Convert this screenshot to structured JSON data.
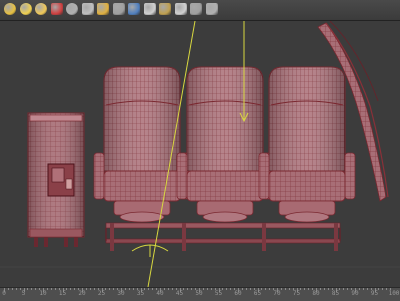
{
  "toolbar": {
    "tools": [
      {
        "icon": "sun-light-icon",
        "color": "#e8c040"
      },
      {
        "icon": "sun-light-icon",
        "color": "#f0d050"
      },
      {
        "icon": "omni-light-icon",
        "color": "#f0c858"
      },
      {
        "icon": "flag-icon",
        "color": "#d04040"
      },
      {
        "icon": "sphere-icon",
        "color": "#b0b0b0"
      },
      {
        "icon": "teapot-icon",
        "color": "#c0c0c0"
      },
      {
        "icon": "lights-icon",
        "color": "#e0b040"
      },
      {
        "icon": "camera-icon",
        "color": "#a0a0a0"
      },
      {
        "icon": "color-swatch-icon",
        "color": "#5080c0"
      },
      {
        "icon": "render-icon",
        "color": "#d0d0d0"
      },
      {
        "icon": "render-frame-icon",
        "color": "#c0a050"
      },
      {
        "icon": "teapot-render-icon",
        "color": "#d0d0d0"
      },
      {
        "icon": "grid-icon",
        "color": "#a0a0a0"
      },
      {
        "icon": "window-icon",
        "color": "#b0b0b0"
      }
    ]
  },
  "viewport": {
    "wireframe_color": "#c05058",
    "mesh_fill": "#b88088",
    "guide_color": "#d8d840"
  },
  "timeline": {
    "ticks": [
      "0",
      "5",
      "10",
      "15",
      "20",
      "25",
      "30",
      "35",
      "40",
      "45",
      "50",
      "55",
      "60",
      "65",
      "70",
      "75",
      "80",
      "85",
      "90",
      "95",
      "100"
    ]
  }
}
